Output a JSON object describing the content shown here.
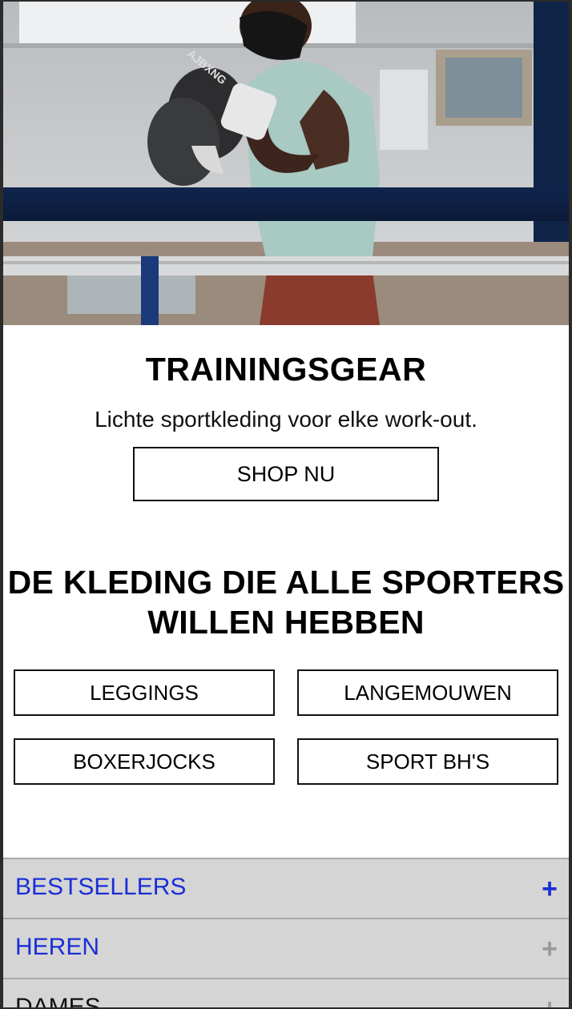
{
  "hero": {
    "image_name": "boxer-training-photo",
    "glove_text": "AJBXNG"
  },
  "promo": {
    "title": "TRAININGSGEAR",
    "subtitle": "Lichte sportkleding voor elke work-out.",
    "cta_label": "SHOP NU"
  },
  "section": {
    "title_line1": "DE KLEDING DIE ALLE SPORTERS",
    "title_line2": "WILLEN HEBBEN"
  },
  "categories": [
    {
      "label": "LEGGINGS"
    },
    {
      "label": "LANGEMOUWEN"
    },
    {
      "label": "BOXERJOCKS"
    },
    {
      "label": "SPORT BH'S"
    }
  ],
  "accordion": [
    {
      "label": "BESTSELLERS",
      "icon": "plus-icon",
      "label_color": "#1a2ed6",
      "icon_color": "#1a2ed6"
    },
    {
      "label": "HEREN",
      "icon": "plus-icon",
      "label_color": "#1a2ed6",
      "icon_color": "#9a9a9a"
    },
    {
      "label": "DAMES",
      "icon": "plus-icon",
      "label_color": "#111111",
      "icon_color": "#9a9a9a"
    }
  ],
  "colors": {
    "accent_link": "#1a2ed6",
    "accordion_bg": "#d5d5d5"
  }
}
